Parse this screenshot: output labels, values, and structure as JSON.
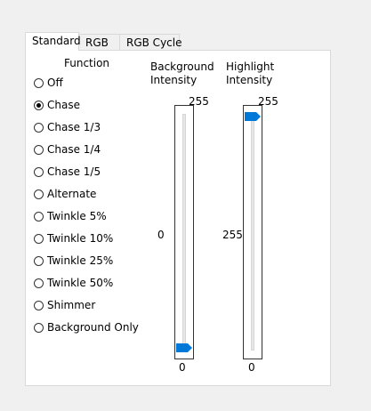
{
  "tabs": [
    {
      "label": "Standard",
      "active": true
    },
    {
      "label": "RGB",
      "active": false
    },
    {
      "label": "RGB Cycle",
      "active": false
    }
  ],
  "function": {
    "title": "Function",
    "options": [
      "Off",
      "Chase",
      "Chase 1/3",
      "Chase 1/4",
      "Chase 1/5",
      "Alternate",
      "Twinkle 5%",
      "Twinkle 10%",
      "Twinkle 25%",
      "Twinkle 50%",
      "Shimmer",
      "Background Only"
    ],
    "selected": "Chase"
  },
  "background_intensity": {
    "title_line1": "Background",
    "title_line2": "Intensity",
    "max_label": "255",
    "min_label": "0",
    "value_label": "0",
    "value": 0,
    "max": 255
  },
  "highlight_intensity": {
    "title_line1": "Highlight",
    "title_line2": "Intensity",
    "max_label": "255",
    "min_label": "0",
    "value_label": "255",
    "value": 255,
    "max": 255
  },
  "colors": {
    "thumb": "#0078d7"
  }
}
